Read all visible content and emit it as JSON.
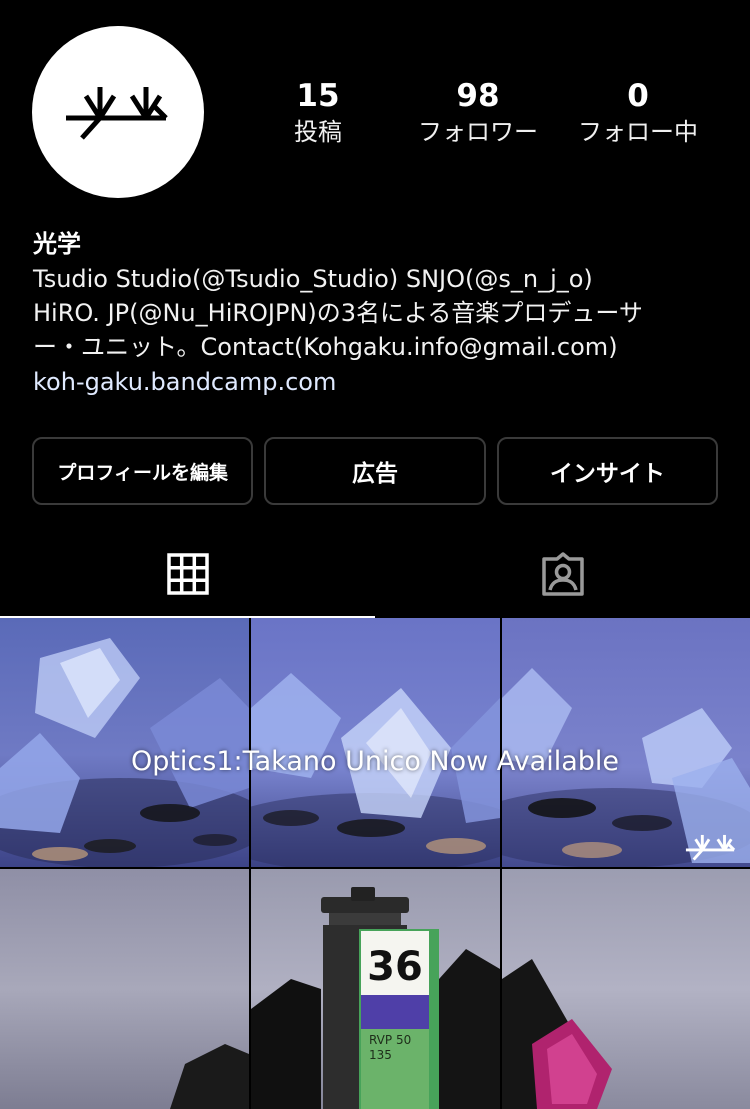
{
  "profile": {
    "avatar_icon": "kohgaku-logo-icon",
    "stats": [
      {
        "value": "15",
        "label": "投稿"
      },
      {
        "value": "98",
        "label": "フォロワー"
      },
      {
        "value": "0",
        "label": "フォロー中"
      }
    ],
    "name": "光学",
    "bio_lines": [
      "Tsudio Studio(@Tsudio_Studio) SNJO(@s_n_j_o)",
      "HiRO. JP(@Nu_HiROJPN)の3名による音楽プロデューサ",
      "ー・ユニット。Contact(Kohgaku.info@gmail.com)"
    ],
    "link": "koh-gaku.bandcamp.com"
  },
  "actions": {
    "edit_profile": "プロフィールを編集",
    "ads": "広告",
    "insights": "インサイト"
  },
  "tabs": [
    {
      "icon": "grid-icon",
      "active": true
    },
    {
      "icon": "tagged-person-icon",
      "active": false
    }
  ],
  "posts": {
    "featured_caption": "Optics1:Takano Unico Now Available",
    "film_label": "36",
    "film_sub1": "RVP 50",
    "film_sub2": "135",
    "colors": {
      "background": "#000000",
      "text": "#ffffff",
      "border": "#3a3a3a"
    }
  }
}
